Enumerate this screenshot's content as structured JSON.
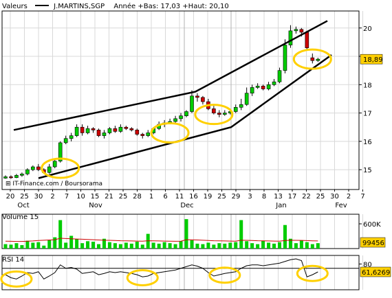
{
  "header": {
    "values_label": "Valeurs",
    "series_name": "J.MARTINS,SGP",
    "stats": "Année +Bas: 17,03 +Haut: 20,10"
  },
  "watermark": "IT-Finance.com / Boursorama",
  "colors": {
    "up": "#00cc00",
    "down": "#cc0000",
    "frame": "#000000",
    "grid": "#d8d8d8",
    "highlight": "#ffd000",
    "volume_avg": "#cc0000"
  },
  "chart_data": [
    {
      "type": "candlestick",
      "price_axis": {
        "ticks": [
          15,
          16,
          17,
          18,
          19,
          20
        ],
        "ylim": [
          14.3,
          20.6
        ],
        "current_value": "18,89"
      },
      "date_axis": {
        "day_labels": [
          "20",
          "25",
          "30",
          "2",
          "7",
          "10",
          "15",
          "21",
          "25",
          "28",
          "1",
          "6",
          "11",
          "16",
          "19",
          "25",
          "29",
          "3",
          "8",
          "13",
          "17",
          "22",
          "25",
          "30",
          "2",
          "7"
        ],
        "month_labels": [
          "Oct",
          "Nov",
          "Dec",
          "Jan",
          "Fev"
        ]
      },
      "candles": [
        [
          14.7,
          14.75,
          14.68,
          14.8
        ],
        [
          14.75,
          14.72,
          14.68,
          14.8
        ],
        [
          14.72,
          14.8,
          14.7,
          14.85
        ],
        [
          14.8,
          14.85,
          14.75,
          14.9
        ],
        [
          14.85,
          15.0,
          14.8,
          15.05
        ],
        [
          15.0,
          15.1,
          14.95,
          15.15
        ],
        [
          15.1,
          15.0,
          14.95,
          15.2
        ],
        [
          15.0,
          14.9,
          14.85,
          15.05
        ],
        [
          14.9,
          15.1,
          14.85,
          15.2
        ],
        [
          15.1,
          15.3,
          15.05,
          15.35
        ],
        [
          15.3,
          15.95,
          15.25,
          16.0
        ],
        [
          15.95,
          16.1,
          15.9,
          16.2
        ],
        [
          16.1,
          16.2,
          16.0,
          16.3
        ],
        [
          16.2,
          16.5,
          16.15,
          16.6
        ],
        [
          16.5,
          16.3,
          16.2,
          16.6
        ],
        [
          16.3,
          16.45,
          16.25,
          16.55
        ],
        [
          16.45,
          16.4,
          16.3,
          16.5
        ],
        [
          16.4,
          16.2,
          16.15,
          16.45
        ],
        [
          16.2,
          16.3,
          16.1,
          16.4
        ],
        [
          16.3,
          16.45,
          16.25,
          16.5
        ],
        [
          16.45,
          16.35,
          16.3,
          16.55
        ],
        [
          16.35,
          16.5,
          16.3,
          16.6
        ],
        [
          16.5,
          16.45,
          16.4,
          16.55
        ],
        [
          16.45,
          16.4,
          16.35,
          16.5
        ],
        [
          16.4,
          16.25,
          16.2,
          16.45
        ],
        [
          16.25,
          16.2,
          16.1,
          16.3
        ],
        [
          16.2,
          16.3,
          16.15,
          16.4
        ],
        [
          16.3,
          16.45,
          16.25,
          16.5
        ],
        [
          16.45,
          16.6,
          16.4,
          16.7
        ],
        [
          16.6,
          16.65,
          16.5,
          16.75
        ],
        [
          16.65,
          16.7,
          16.6,
          16.8
        ],
        [
          16.7,
          16.8,
          16.65,
          16.9
        ],
        [
          16.8,
          16.9,
          16.7,
          17.0
        ],
        [
          16.9,
          17.05,
          16.85,
          17.1
        ],
        [
          17.05,
          17.6,
          17.0,
          17.8
        ],
        [
          17.6,
          17.55,
          17.4,
          17.7
        ],
        [
          17.55,
          17.4,
          17.3,
          17.6
        ],
        [
          17.4,
          17.15,
          17.1,
          17.5
        ],
        [
          17.15,
          17.0,
          16.95,
          17.25
        ],
        [
          17.0,
          16.95,
          16.85,
          17.1
        ],
        [
          16.95,
          17.0,
          16.9,
          17.1
        ],
        [
          17.0,
          17.05,
          16.95,
          17.15
        ],
        [
          17.05,
          17.2,
          17.0,
          17.3
        ],
        [
          17.2,
          17.3,
          17.1,
          17.5
        ],
        [
          17.3,
          17.7,
          17.25,
          17.9
        ],
        [
          17.7,
          17.9,
          17.6,
          18.0
        ],
        [
          17.9,
          17.95,
          17.85,
          18.05
        ],
        [
          17.95,
          17.85,
          17.8,
          18.0
        ],
        [
          17.85,
          18.0,
          17.8,
          18.1
        ],
        [
          18.0,
          18.1,
          17.95,
          18.2
        ],
        [
          18.1,
          18.5,
          18.05,
          18.6
        ],
        [
          18.5,
          19.4,
          18.4,
          19.6
        ],
        [
          19.4,
          19.9,
          19.3,
          20.1
        ],
        [
          19.9,
          19.95,
          19.8,
          20.05
        ],
        [
          19.95,
          19.85,
          19.7,
          20.0
        ],
        [
          19.85,
          19.3,
          19.2,
          19.9
        ],
        [
          18.95,
          18.85,
          18.75,
          19.1
        ],
        [
          18.85,
          18.9,
          18.8,
          18.95
        ]
      ],
      "annotations": {
        "channel_upper": [
          [
            20,
            16.4
          ],
          [
            284,
            17.75
          ],
          [
            476,
            20.25
          ]
        ],
        "channel_lower": [
          [
            56,
            14.7
          ],
          [
            336,
            16.5
          ],
          [
            482,
            19.05
          ]
        ],
        "highlight_ellipses": [
          [
            10,
            15.05
          ],
          [
            30,
            16.3
          ],
          [
            38,
            16.95
          ],
          [
            56,
            18.9
          ]
        ]
      }
    },
    {
      "type": "bar",
      "title": "Volume 15",
      "axis_labels": [
        "600K",
        "99456"
      ],
      "volumes": [
        90,
        80,
        110,
        70,
        160,
        120,
        130,
        60,
        170,
        230,
        580,
        120,
        260,
        190,
        110,
        150,
        140,
        90,
        200,
        130,
        110,
        90,
        120,
        100,
        140,
        80,
        300,
        120,
        100,
        130,
        110,
        90,
        150,
        600,
        170,
        100,
        90,
        120,
        80,
        110,
        100,
        120,
        130,
        580,
        150,
        110,
        90,
        160,
        120,
        100,
        130,
        480,
        200,
        110,
        170,
        130,
        90,
        110
      ],
      "volume_avg": [
        150,
        148,
        146,
        145,
        150,
        155,
        165,
        170,
        175,
        180,
        210,
        205,
        200,
        195,
        190,
        185,
        180,
        175,
        170,
        168,
        165,
        160,
        158,
        155,
        152,
        150,
        160,
        158,
        155,
        152,
        150,
        148,
        150,
        180,
        178,
        175,
        170,
        165,
        160,
        158,
        155,
        152,
        150,
        170,
        168,
        165,
        160,
        158,
        155,
        152,
        150,
        165,
        170,
        168,
        166,
        162,
        158,
        155
      ]
    },
    {
      "type": "line",
      "title": "RSI 14",
      "axis_labels": [
        "80",
        "61,6269"
      ],
      "rsi": [
        55,
        48,
        45,
        52,
        60,
        58,
        62,
        45,
        52,
        60,
        78,
        70,
        72,
        68,
        58,
        60,
        62,
        55,
        58,
        62,
        60,
        62,
        60,
        58,
        55,
        50,
        52,
        58,
        60,
        62,
        64,
        66,
        70,
        74,
        78,
        75,
        70,
        60,
        52,
        55,
        58,
        60,
        62,
        70,
        76,
        78,
        78,
        76,
        78,
        80,
        82,
        86,
        90,
        92,
        88,
        50,
        55,
        61.6
      ],
      "highlight_ellipses": [
        [
          2,
          45
        ],
        [
          25,
          48
        ],
        [
          40,
          54
        ],
        [
          56,
          58
        ]
      ]
    }
  ]
}
